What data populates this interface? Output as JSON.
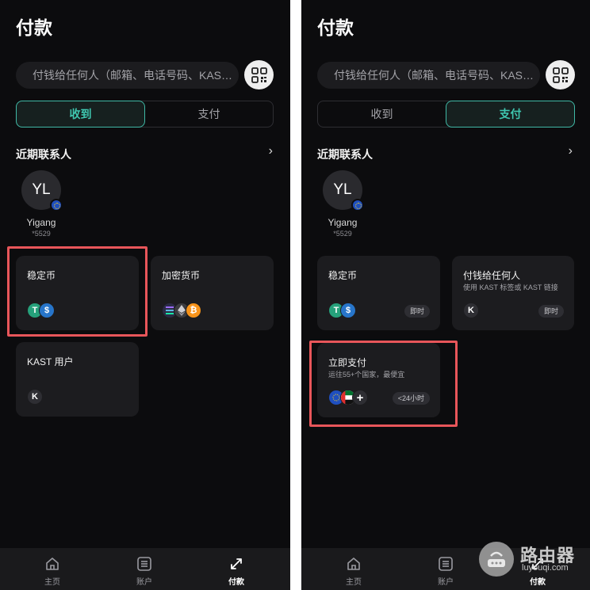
{
  "left": {
    "title": "付款",
    "search_placeholder": "付钱给任何人（邮箱、电话号码、KAST ID）",
    "segment": {
      "tabs": [
        "收到",
        "支付"
      ],
      "active": 0
    },
    "recent": {
      "title": "近期联系人",
      "arrow": "›"
    },
    "contact": {
      "initials": "YL",
      "name": "Yigang",
      "sub": "*5529"
    },
    "cards": [
      {
        "title": "稳定币",
        "icons": [
          "tether-icon",
          "usdc-icon"
        ]
      },
      {
        "title": "加密货币",
        "icons": [
          "solana-icon",
          "ethereum-icon",
          "bitcoin-icon"
        ]
      },
      {
        "title": "KAST 用户",
        "icons": [
          "kast-icon"
        ]
      }
    ],
    "tabbar": [
      "主页",
      "账户",
      "付款"
    ],
    "tabbar_active": 2
  },
  "right": {
    "title": "付款",
    "search_placeholder": "付钱给任何人（邮箱、电话号码、KAST ID）",
    "segment": {
      "tabs": [
        "收到",
        "支付"
      ],
      "active": 1
    },
    "recent": {
      "title": "近期联系人",
      "arrow": "›"
    },
    "contact": {
      "initials": "YL",
      "name": "Yigang",
      "sub": "*5529"
    },
    "cards": [
      {
        "title": "稳定币",
        "badge": "即时",
        "icons": [
          "tether-icon",
          "usdc-icon"
        ]
      },
      {
        "title": "付钱给任何人",
        "sub": "使用 KAST 标签或 KAST 链接",
        "badge": "即时",
        "icons": [
          "kast-icon"
        ]
      },
      {
        "title": "立即支付",
        "sub": "运往55+个国家，最便宜",
        "badge": "<24小时",
        "icons": [
          "eu-flag-icon",
          "uae-flag-icon",
          "plus-icon"
        ]
      }
    ],
    "tabbar": [
      "主页",
      "账户",
      "付款"
    ],
    "tabbar_active": 2
  },
  "watermark": {
    "name": "路由器",
    "url": "luyouqi.com"
  },
  "colors": {
    "accent": "#3fc7b0",
    "highlight": "#e8565a",
    "background": "#0c0c0e",
    "card": "#1c1c1f"
  }
}
